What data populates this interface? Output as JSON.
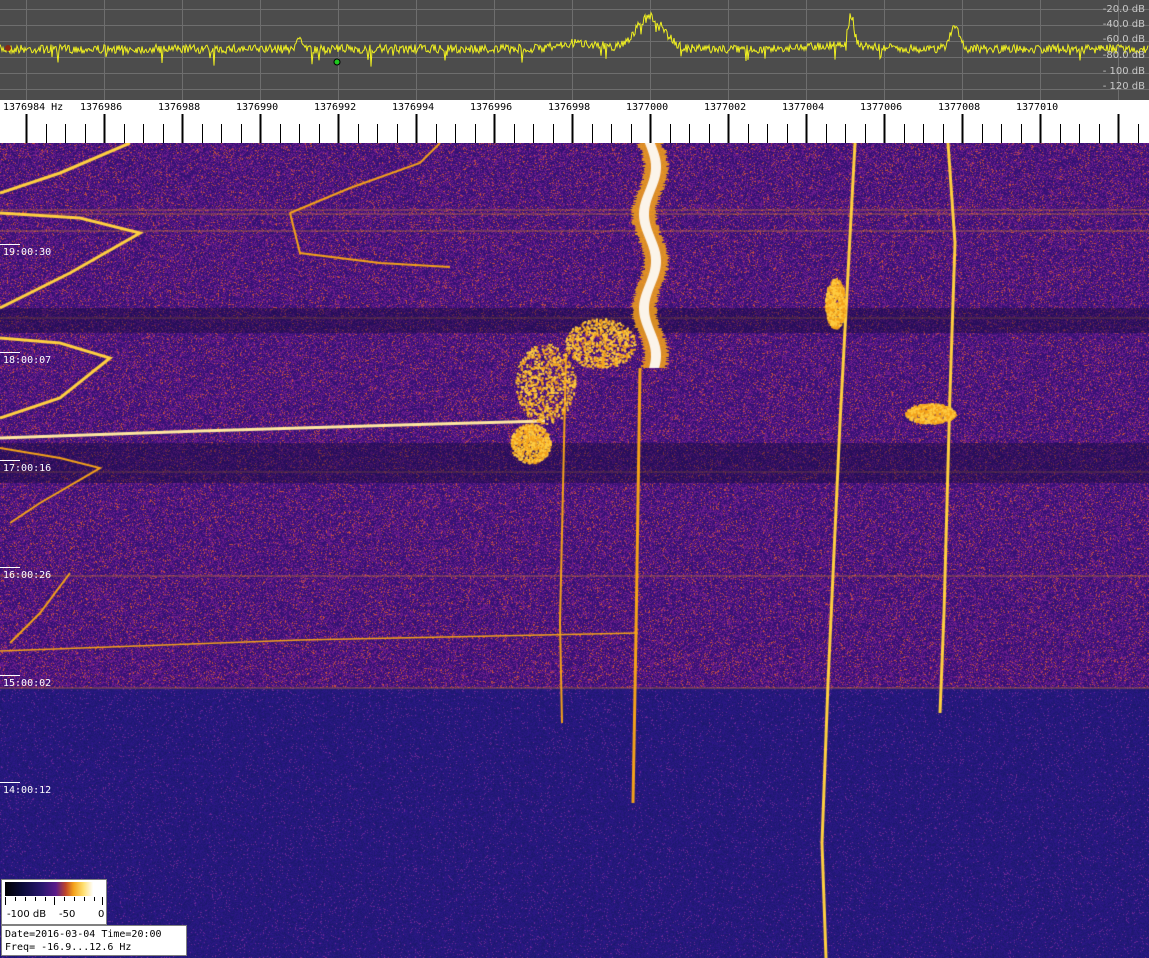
{
  "spectrum": {
    "db_labels": [
      "-20.0 dB",
      "-40.0 dB",
      "-60.0 dB",
      "-80.0 dB",
      "- 100 dB",
      "- 120 dB"
    ],
    "trace_color": "#f0f020"
  },
  "freq_axis": {
    "labels": [
      "1376984 Hz",
      "1376986",
      "1376988",
      "1376990",
      "1376992",
      "1376994",
      "1376996",
      "1376998",
      "1377000",
      "1377002",
      "1377004",
      "1377006",
      "1377008",
      "1377010"
    ]
  },
  "waterfall": {
    "time_labels": [
      "19:00:30",
      "18:00:07",
      "17:00:16",
      "16:00:26",
      "15:00:02",
      "14:00:12"
    ],
    "colors": {
      "background_upper": "#3a1370",
      "background_lower": "#221a78",
      "signal": "#f4a21a",
      "peak": "#ffffff"
    }
  },
  "colorbar": {
    "labels": [
      "-100 dB",
      "-50",
      "0"
    ]
  },
  "info": {
    "line1": "Date=2016-03-04 Time=20:00",
    "line2": "Freq= -16.9...12.6 Hz"
  }
}
